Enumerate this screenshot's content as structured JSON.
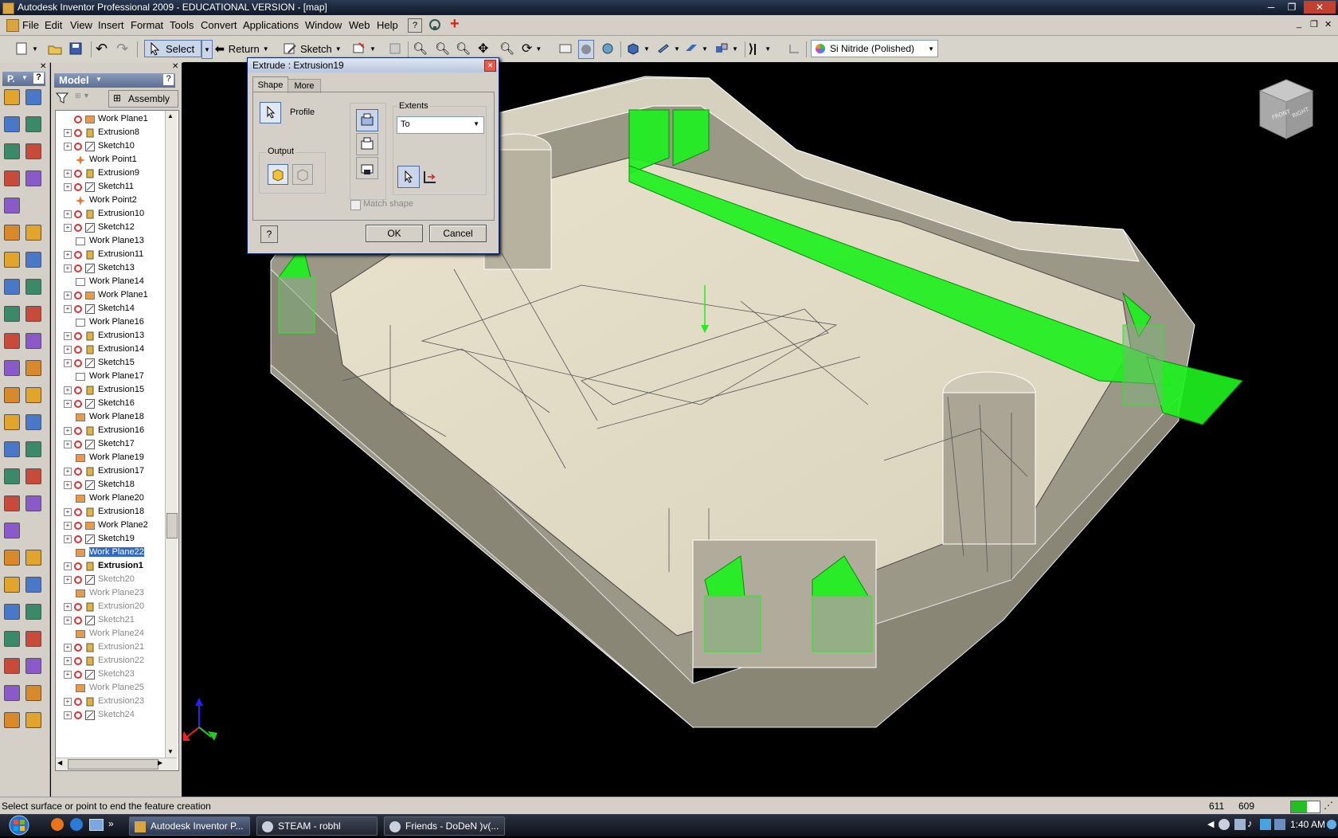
{
  "window": {
    "title": "Autodesk Inventor Professional 2009 - EDUCATIONAL VERSION - [map]",
    "controls": [
      "─",
      "❐",
      "✕"
    ]
  },
  "menu": {
    "items": [
      "File",
      "Edit",
      "View",
      "Insert",
      "Format",
      "Tools",
      "Convert",
      "Applications",
      "Window",
      "Web",
      "Help"
    ]
  },
  "toolbar": {
    "select_label": "Select",
    "return_label": "Return",
    "sketch_label": "Sketch",
    "material_value": "Si Nitride (Polished)"
  },
  "panel_bar": {
    "label": "P.",
    "help": "?"
  },
  "browser": {
    "header": "Model",
    "help": "?",
    "assembly_label": "Assembly",
    "tree": [
      {
        "label": "Work Plane1",
        "kind": "plane-feature",
        "expand": false
      },
      {
        "label": "Extrusion8",
        "kind": "extrusion",
        "expand": true
      },
      {
        "label": "Sketch10",
        "kind": "sketch",
        "expand": true
      },
      {
        "label": "Work Point1",
        "kind": "point",
        "expand": false
      },
      {
        "label": "Extrusion9",
        "kind": "extrusion",
        "expand": true
      },
      {
        "label": "Sketch11",
        "kind": "sketch",
        "expand": true
      },
      {
        "label": "Work Point2",
        "kind": "point",
        "expand": false
      },
      {
        "label": "Extrusion10",
        "kind": "extrusion",
        "expand": true
      },
      {
        "label": "Sketch12",
        "kind": "sketch",
        "expand": true
      },
      {
        "label": "Work Plane13",
        "kind": "plane",
        "expand": false
      },
      {
        "label": "Extrusion11",
        "kind": "extrusion",
        "expand": true
      },
      {
        "label": "Sketch13",
        "kind": "sketch",
        "expand": true
      },
      {
        "label": "Work Plane14",
        "kind": "plane",
        "expand": false
      },
      {
        "label": "Work Plane1",
        "kind": "plane-feature",
        "expand": true
      },
      {
        "label": "Sketch14",
        "kind": "sketch",
        "expand": true
      },
      {
        "label": "Work Plane16",
        "kind": "plane",
        "expand": false
      },
      {
        "label": "Extrusion13",
        "kind": "extrusion",
        "expand": true
      },
      {
        "label": "Extrusion14",
        "kind": "extrusion",
        "expand": true
      },
      {
        "label": "Sketch15",
        "kind": "sketch",
        "expand": true
      },
      {
        "label": "Work Plane17",
        "kind": "plane",
        "expand": false
      },
      {
        "label": "Extrusion15",
        "kind": "extrusion",
        "expand": true
      },
      {
        "label": "Sketch16",
        "kind": "sketch",
        "expand": true
      },
      {
        "label": "Work Plane18",
        "kind": "plane-orange",
        "expand": false
      },
      {
        "label": "Extrusion16",
        "kind": "extrusion",
        "expand": true
      },
      {
        "label": "Sketch17",
        "kind": "sketch",
        "expand": true
      },
      {
        "label": "Work Plane19",
        "kind": "plane-orange",
        "expand": false
      },
      {
        "label": "Extrusion17",
        "kind": "extrusion",
        "expand": true
      },
      {
        "label": "Sketch18",
        "kind": "sketch",
        "expand": true
      },
      {
        "label": "Work Plane20",
        "kind": "plane-orange",
        "expand": false
      },
      {
        "label": "Extrusion18",
        "kind": "extrusion",
        "expand": true
      },
      {
        "label": "Work Plane2",
        "kind": "plane-feature",
        "expand": true
      },
      {
        "label": "Sketch19",
        "kind": "sketch",
        "expand": true
      },
      {
        "label": "Work Plane22",
        "kind": "plane-orange",
        "expand": false,
        "selected": true
      },
      {
        "label": "Extrusion1",
        "kind": "extrusion",
        "expand": true,
        "bold": true
      },
      {
        "label": "Sketch20",
        "kind": "sketch",
        "expand": true,
        "grey": true
      },
      {
        "label": "Work Plane23",
        "kind": "plane-orange",
        "expand": false,
        "grey": true
      },
      {
        "label": "Extrusion20",
        "kind": "extrusion",
        "expand": true,
        "grey": true
      },
      {
        "label": "Sketch21",
        "kind": "sketch",
        "expand": true,
        "grey": true
      },
      {
        "label": "Work Plane24",
        "kind": "plane-orange",
        "expand": false,
        "grey": true
      },
      {
        "label": "Extrusion21",
        "kind": "extrusion",
        "expand": true,
        "grey": true
      },
      {
        "label": "Extrusion22",
        "kind": "extrusion",
        "expand": true,
        "grey": true
      },
      {
        "label": "Sketch23",
        "kind": "sketch",
        "expand": true,
        "grey": true
      },
      {
        "label": "Work Plane25",
        "kind": "plane-orange",
        "expand": false,
        "grey": true
      },
      {
        "label": "Extrusion23",
        "kind": "extrusion",
        "expand": true,
        "grey": true
      },
      {
        "label": "Sketch24",
        "kind": "sketch",
        "expand": true,
        "grey": true
      }
    ]
  },
  "dialog": {
    "title": "Extrude : Extrusion19",
    "tab_shape": "Shape",
    "tab_more": "More",
    "profile_label": "Profile",
    "output_label": "Output",
    "extents_label": "Extents",
    "extents_value": "To",
    "match_shape_label": "Match shape",
    "ok_label": "OK",
    "cancel_label": "Cancel",
    "help": "?",
    "close": "✕"
  },
  "viewcube": {
    "faces": [
      "FRONT",
      "RIGHT"
    ]
  },
  "status": {
    "prompt": "Select surface or point to end the feature creation",
    "x": "611",
    "y": "609"
  },
  "taskbar": {
    "tasks": [
      "Autodesk Inventor P...",
      "STEAM - robhl",
      "Friends - DoDeN )v(..."
    ],
    "quick": "»",
    "clock": "1:40 AM"
  },
  "colors": {
    "selection_green": "#1ef01e",
    "model_beige": "#d8d3c2",
    "menu_grey": "#d4d0c8"
  }
}
